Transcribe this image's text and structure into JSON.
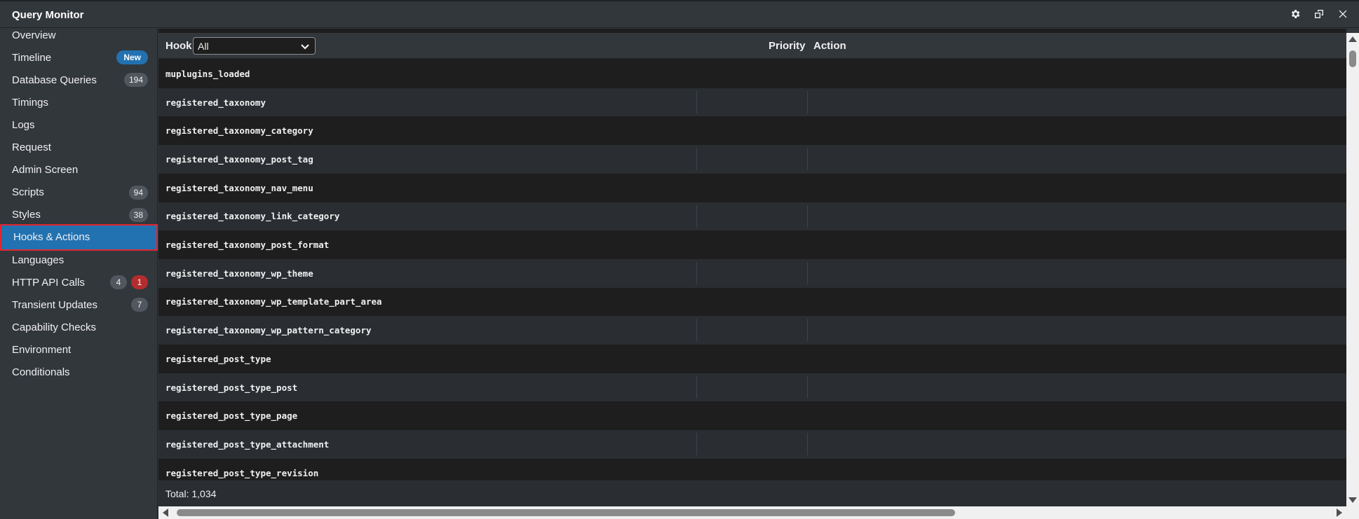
{
  "window": {
    "title": "Query Monitor",
    "icons": [
      "gear-icon",
      "pop-out-icon",
      "close-icon"
    ]
  },
  "sidebar": {
    "items": [
      {
        "label": "Overview",
        "badges": []
      },
      {
        "label": "Timeline",
        "badges": [
          {
            "text": "New",
            "kind": "new"
          }
        ]
      },
      {
        "label": "Database Queries",
        "badges": [
          {
            "text": "194",
            "kind": "count"
          }
        ]
      },
      {
        "label": "Timings",
        "badges": []
      },
      {
        "label": "Logs",
        "badges": []
      },
      {
        "label": "Request",
        "badges": []
      },
      {
        "label": "Admin Screen",
        "badges": []
      },
      {
        "label": "Scripts",
        "badges": [
          {
            "text": "94",
            "kind": "count"
          }
        ]
      },
      {
        "label": "Styles",
        "badges": [
          {
            "text": "38",
            "kind": "count"
          }
        ]
      },
      {
        "label": "Hooks & Actions",
        "badges": [],
        "active": true
      },
      {
        "label": "Languages",
        "badges": []
      },
      {
        "label": "HTTP API Calls",
        "badges": [
          {
            "text": "4",
            "kind": "count"
          },
          {
            "text": "1",
            "kind": "error"
          }
        ]
      },
      {
        "label": "Transient Updates",
        "badges": [
          {
            "text": "7",
            "kind": "count"
          }
        ]
      },
      {
        "label": "Capability Checks",
        "badges": []
      },
      {
        "label": "Environment",
        "badges": []
      },
      {
        "label": "Conditionals",
        "badges": []
      }
    ]
  },
  "table": {
    "headers": {
      "hook": "Hook",
      "priority": "Priority",
      "action": "Action"
    },
    "filter": {
      "selected": "All"
    },
    "rows": [
      "muplugins_loaded",
      "registered_taxonomy",
      "registered_taxonomy_category",
      "registered_taxonomy_post_tag",
      "registered_taxonomy_nav_menu",
      "registered_taxonomy_link_category",
      "registered_taxonomy_post_format",
      "registered_taxonomy_wp_theme",
      "registered_taxonomy_wp_template_part_area",
      "registered_taxonomy_wp_pattern_category",
      "registered_post_type",
      "registered_post_type_post",
      "registered_post_type_page",
      "registered_post_type_attachment",
      "registered_post_type_revision"
    ],
    "total": "Total: 1,034"
  },
  "colors": {
    "panel": "#32373c",
    "content": "#1e1e1e",
    "row_alt": "#2a2e32",
    "accent": "#2271b1",
    "highlight_border": "#e0272e",
    "error_badge": "#b32d2e"
  }
}
